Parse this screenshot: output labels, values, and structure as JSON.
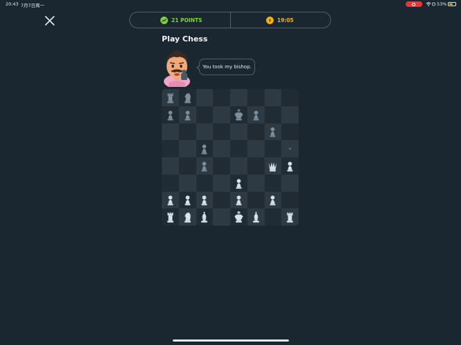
{
  "status_bar": {
    "time": "20:43",
    "date": "7月7日周一",
    "battery": "53%"
  },
  "stats": {
    "points": "21 POINTS",
    "timer": "19:05"
  },
  "title": "Play Chess",
  "opponent": {
    "speech": "You took my bishop."
  },
  "colors": {
    "points": "#7fd33a",
    "timer": "#f5b400",
    "white_piece": "#d7e3ec",
    "black_piece": "#7d8f9c"
  },
  "board": {
    "rows": [
      [
        "br",
        "bn",
        "",
        "",
        "",
        "",
        "",
        ""
      ],
      [
        "bp",
        "bp",
        "",
        "",
        "bk",
        "bp",
        "",
        ""
      ],
      [
        "",
        "",
        "",
        "",
        "",
        "",
        "bp",
        ""
      ],
      [
        "",
        "",
        "bp",
        "",
        "",
        "",
        "",
        "."
      ],
      [
        "",
        "",
        "bp",
        "",
        "",
        "",
        "wq",
        "wp"
      ],
      [
        "",
        "",
        "",
        "",
        "wp",
        "",
        "",
        ""
      ],
      [
        "wp",
        "wp",
        "wp",
        "",
        "wp",
        "",
        "wp",
        ""
      ],
      [
        "wr",
        "wn",
        "wb",
        "",
        "wk",
        "wb",
        "",
        "wr"
      ]
    ]
  }
}
